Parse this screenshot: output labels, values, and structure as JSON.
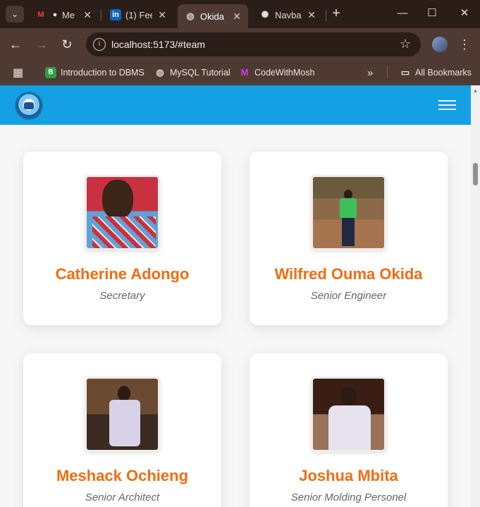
{
  "browser": {
    "tabs": [
      {
        "title": "Me",
        "favicon": "gmail-icon",
        "active": false
      },
      {
        "title": "(1) Fee",
        "favicon": "linkedin-icon",
        "active": false
      },
      {
        "title": "Okida",
        "favicon": "globe-icon",
        "active": true
      },
      {
        "title": "Navba",
        "favicon": "openai-icon",
        "active": false
      }
    ],
    "new_tab_symbol": "+",
    "url": "localhost:5173/#team",
    "bookmarks": [
      {
        "label": "Introduction to DBMS",
        "icon": "dbms-icon"
      },
      {
        "label": "MySQL Tutorial",
        "icon": "globe-icon"
      },
      {
        "label": "CodeWithMosh",
        "icon": "mosh-icon"
      }
    ],
    "overflow_symbol": "»",
    "all_bookmarks_label": "All Bookmarks"
  },
  "site": {
    "nav_color": "#14a0e3",
    "accent_color": "#f06d12"
  },
  "team": [
    {
      "name": "Catherine Adongo",
      "role": "Secretary"
    },
    {
      "name": "Wilfred Ouma Okida",
      "role": "Senior Engineer"
    },
    {
      "name": "Meshack Ochieng",
      "role": "Senior Architect"
    },
    {
      "name": "Joshua Mbita",
      "role": "Senior Molding Personel"
    }
  ]
}
